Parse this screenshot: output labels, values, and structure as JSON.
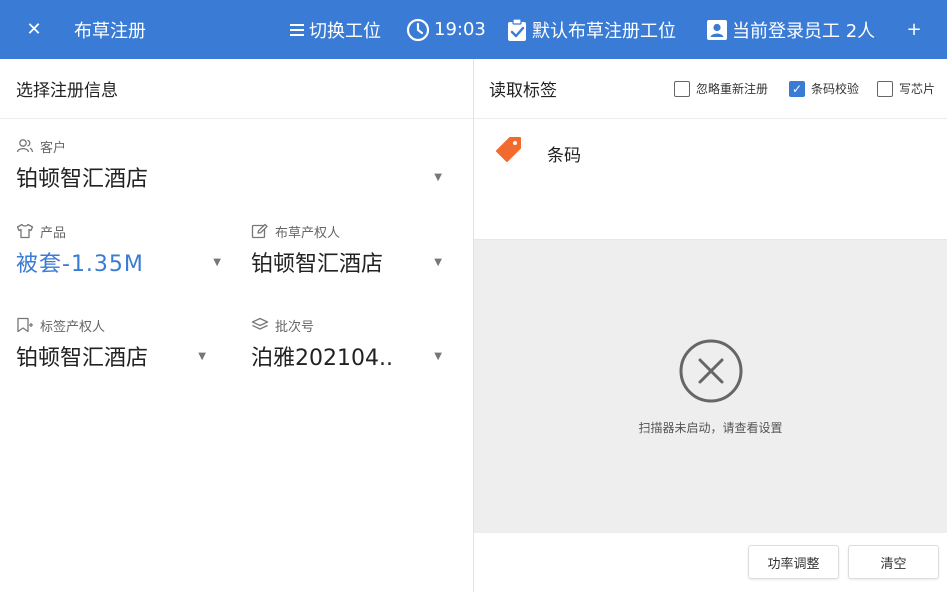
{
  "header": {
    "close_icon": "close-icon",
    "title": "布草注册",
    "switch_label": "切换工位",
    "time": "19:03",
    "default_station": "默认布草注册工位",
    "staff_label": "当前登录员工 2人",
    "plus_icon": "plus-icon",
    "bg_color": "#3a7bd5"
  },
  "left": {
    "heading": "选择注册信息",
    "customer": {
      "label": "客户",
      "value": "铂顿智汇酒店"
    },
    "product": {
      "label": "产品",
      "value": "被套-1.35M"
    },
    "linen_owner": {
      "label": "布草产权人",
      "value": "铂顿智汇酒店"
    },
    "tag_owner": {
      "label": "标签产权人",
      "value": "铂顿智汇酒店"
    },
    "batch": {
      "label": "批次号",
      "value": "泊雅202104.."
    }
  },
  "right": {
    "heading": "读取标签",
    "options": [
      {
        "label": "忽略重新注册",
        "checked": false
      },
      {
        "label": "条码校验",
        "checked": true
      },
      {
        "label": "写芯片",
        "checked": false
      }
    ],
    "barcode_label": "条码",
    "status_text": "扫描器未启动，请查看设置",
    "buttons": {
      "power": "功率调整",
      "clear": "清空"
    }
  }
}
